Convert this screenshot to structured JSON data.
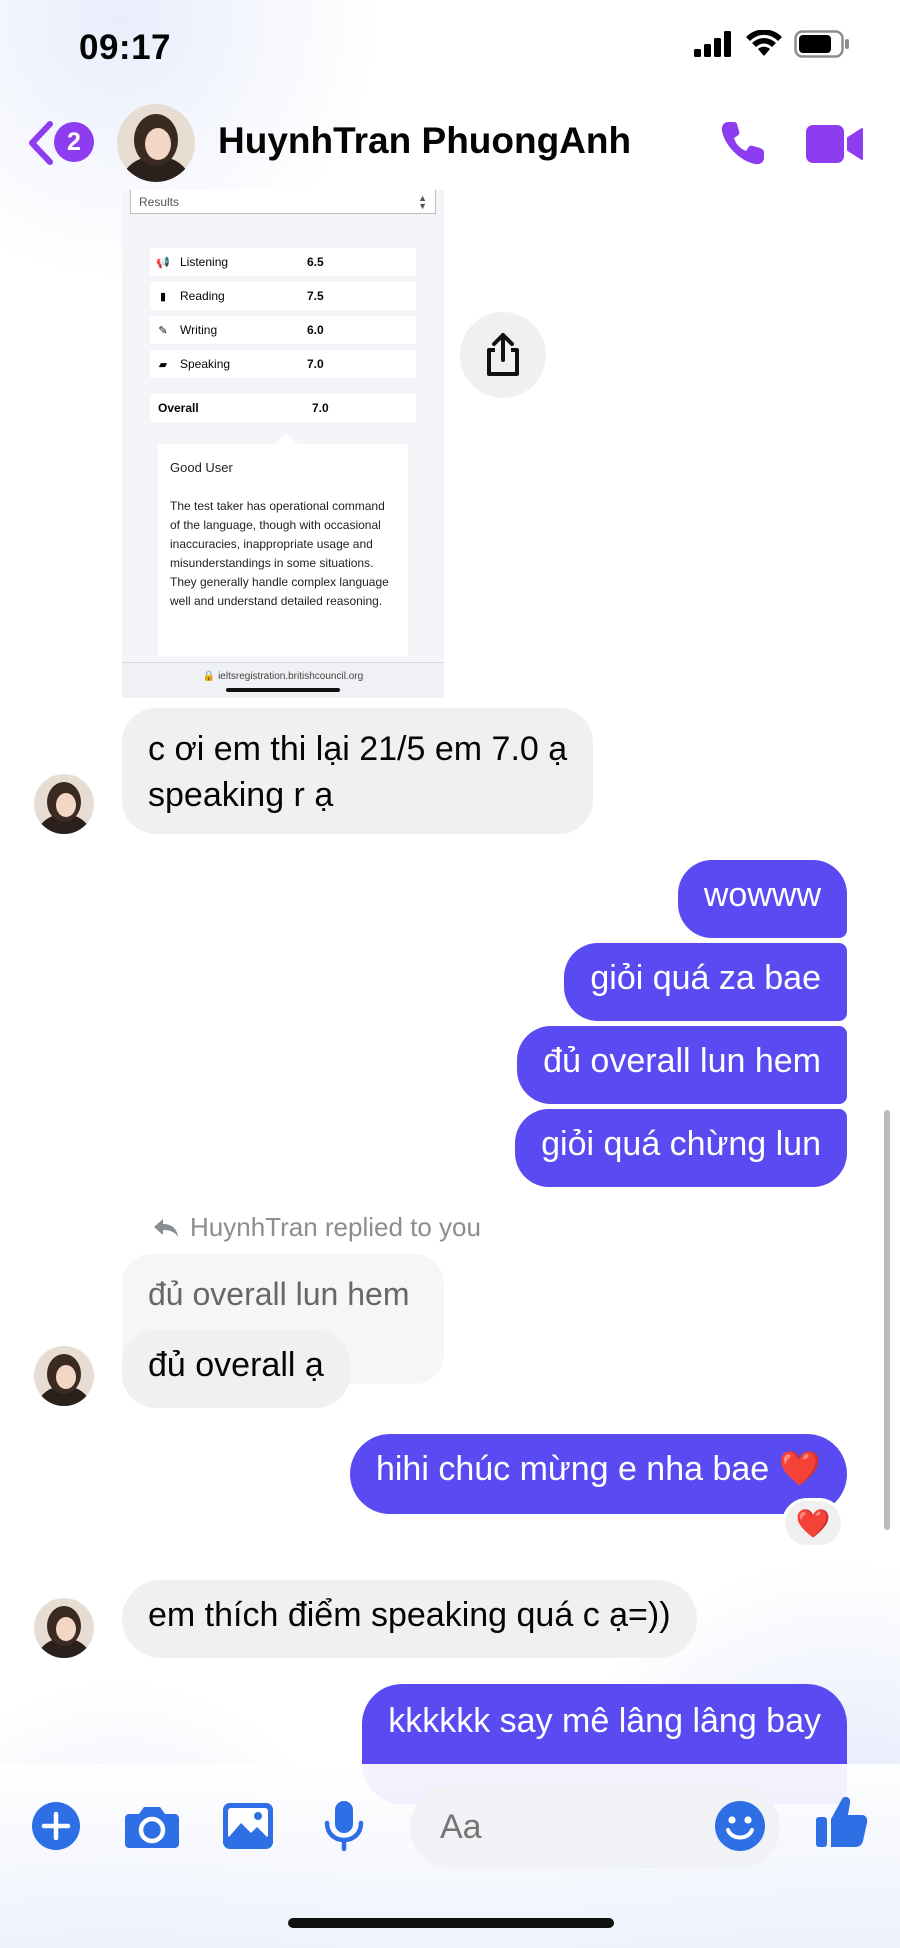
{
  "status_bar": {
    "time": "09:17"
  },
  "header": {
    "back_badge": "2",
    "contact_name": "HuynhTran PhuongAnh"
  },
  "shared_screenshot": {
    "dropdown": "Results",
    "rows": [
      {
        "icon": "megaphone-icon",
        "label": "Listening",
        "value": "6.5"
      },
      {
        "icon": "book-icon",
        "label": "Reading",
        "value": "7.5"
      },
      {
        "icon": "pencil-icon",
        "label": "Writing",
        "value": "6.0"
      },
      {
        "icon": "speech-bubbles-icon",
        "label": "Speaking",
        "value": "7.0"
      }
    ],
    "overall_label": "Overall",
    "overall_value": "7.0",
    "band_title": "Good User",
    "band_description": "The test taker has operational command of the language, though with occasional inaccuracies, inappropriate usage and misunderstandings in some situations. They generally handle complex language well and understand detailed reasoning.",
    "url": "ieltsregistration.britishcouncil.org"
  },
  "messages": {
    "m1_line1": "c ơi em thi lại 21/5 em 7.0 ạ",
    "m1_line2": "speaking r ạ",
    "m2": "wowww",
    "m3": "giỏi quá za bae",
    "m4": "đủ overall lun hem",
    "m5": "giỏi quá chừng lun",
    "reply_note": "HuynhTran replied to you",
    "quoted": "đủ overall lun hem",
    "m6": "đủ overall ạ",
    "m7": "hihi chúc mừng e nha bae ❤️",
    "reaction": "❤️",
    "m8": "em thích điểm speaking quá c ạ=))",
    "m9": "kkkkkk say mê lâng lâng bay"
  },
  "composer": {
    "placeholder": "Aa"
  },
  "colors": {
    "accent": "#8e3cf0",
    "outgoing_bubble": "#5a4af1",
    "incoming_bubble": "#f0f0f0",
    "composer_icons": "#2e6fe6"
  }
}
